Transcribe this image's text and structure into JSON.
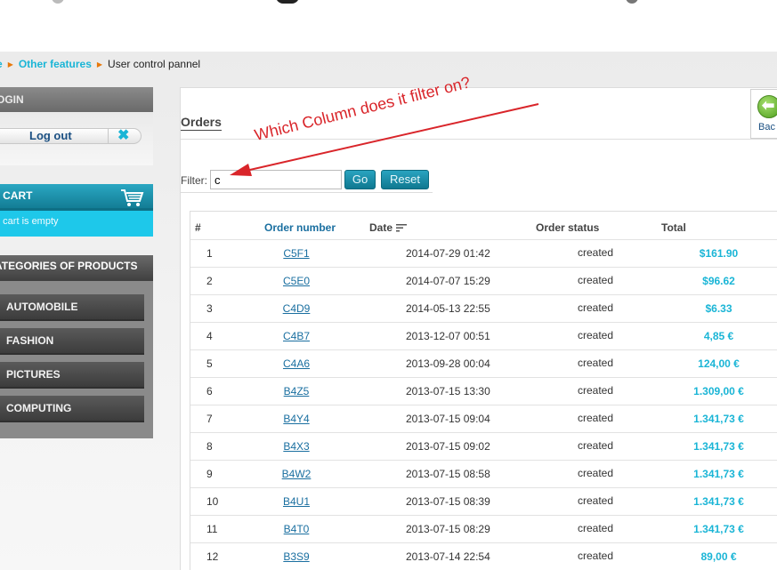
{
  "breadcrumb": {
    "items": [
      "e",
      "Other features"
    ],
    "current": "User control pannel"
  },
  "sidebar": {
    "login": {
      "title": "OGIN",
      "logout_label": "Log out"
    },
    "cart": {
      "title": "Y CART",
      "empty_text": "e cart is empty"
    },
    "categories": {
      "title": "ATEGORIES OF PRODUCTS",
      "items": [
        "AUTOMOBILE",
        "FASHION",
        "PICTURES",
        "COMPUTING"
      ]
    }
  },
  "main": {
    "title": "Orders",
    "back_label": "Bac",
    "filter": {
      "label": "Filter:",
      "value": "c",
      "go_label": "Go",
      "reset_label": "Reset"
    },
    "annotation": "Which Column does it filter on?",
    "table": {
      "headers": {
        "num": "#",
        "order": "Order number",
        "date": "Date",
        "status": "Order status",
        "total": "Total"
      },
      "rows": [
        {
          "num": "1",
          "order": "C5F1",
          "date": "2014-07-29 01:42",
          "status": "created",
          "total": "$161.90"
        },
        {
          "num": "2",
          "order": "C5E0",
          "date": "2014-07-07 15:29",
          "status": "created",
          "total": "$96.62"
        },
        {
          "num": "3",
          "order": "C4D9",
          "date": "2014-05-13 22:55",
          "status": "created",
          "total": "$6.33"
        },
        {
          "num": "4",
          "order": "C4B7",
          "date": "2013-12-07 00:51",
          "status": "created",
          "total": "4,85 €"
        },
        {
          "num": "5",
          "order": "C4A6",
          "date": "2013-09-28 00:04",
          "status": "created",
          "total": "124,00 €"
        },
        {
          "num": "6",
          "order": "B4Z5",
          "date": "2013-07-15 13:30",
          "status": "created",
          "total": "1.309,00 €"
        },
        {
          "num": "7",
          "order": "B4Y4",
          "date": "2013-07-15 09:04",
          "status": "created",
          "total": "1.341,73 €"
        },
        {
          "num": "8",
          "order": "B4X3",
          "date": "2013-07-15 09:02",
          "status": "created",
          "total": "1.341,73 €"
        },
        {
          "num": "9",
          "order": "B4W2",
          "date": "2013-07-15 08:58",
          "status": "created",
          "total": "1.341,73 €"
        },
        {
          "num": "10",
          "order": "B4U1",
          "date": "2013-07-15 08:39",
          "status": "created",
          "total": "1.341,73 €"
        },
        {
          "num": "11",
          "order": "B4T0",
          "date": "2013-07-15 08:29",
          "status": "created",
          "total": "1.341,73 €"
        },
        {
          "num": "12",
          "order": "B3S9",
          "date": "2013-07-14 22:54",
          "status": "created",
          "total": "89,00 €"
        }
      ]
    }
  },
  "colors": {
    "accent": "#1ab5d6",
    "link": "#1a6fa0",
    "annotation": "#d9252a",
    "breadcrumb_arrow": "#e8780a"
  }
}
